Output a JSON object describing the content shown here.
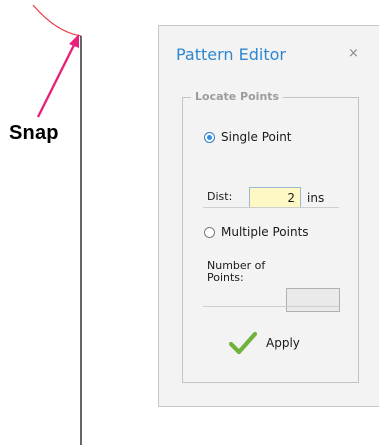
{
  "canvas": {
    "snap_label": "Snap",
    "colors": {
      "arrow": "#e8217a",
      "arc": "#ea3a4a",
      "line": "#000000"
    }
  },
  "dialog": {
    "title": "Pattern Editor",
    "close_label": "×",
    "group_title": "Locate Points",
    "single_point_label": "Single Point",
    "single_point_checked": true,
    "dist_label": "Dist:",
    "dist_value": "2",
    "dist_unit": "ins",
    "multiple_points_label": "Multiple Points",
    "multiple_points_checked": false,
    "number_of_points_label_line1": "Number of",
    "number_of_points_label_line2": "Points:",
    "number_of_points_value": "",
    "apply_label": "Apply",
    "apply_icon": "checkmark-icon",
    "colors": {
      "title": "#2e87d0",
      "checkmark": "#6fb33a",
      "dist_field_bg": "#fdf8c4"
    }
  }
}
